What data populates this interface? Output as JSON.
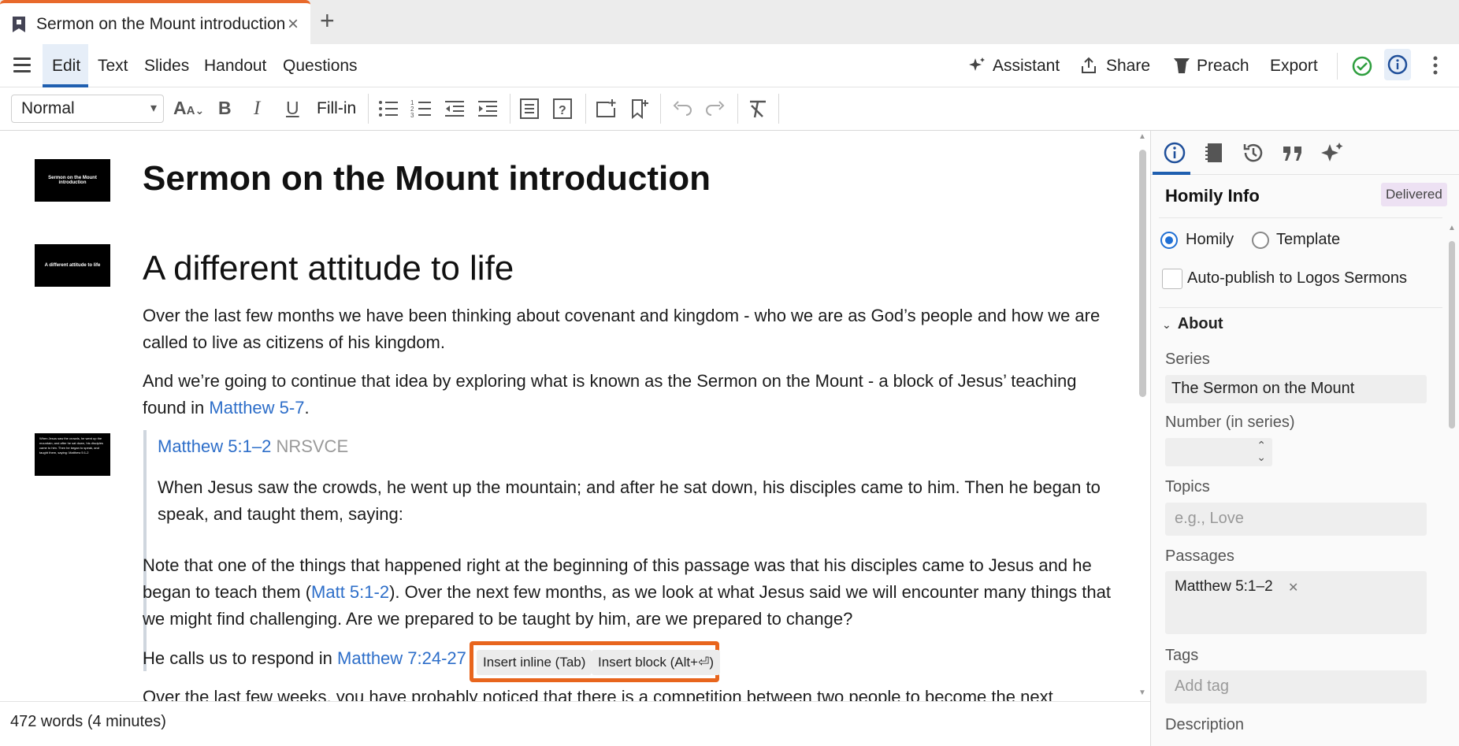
{
  "tab": {
    "title": "Sermon on the Mount introduction",
    "close": "×",
    "new_tab": "+"
  },
  "menu": {
    "items": [
      "Edit",
      "Text",
      "Slides",
      "Handout",
      "Questions"
    ],
    "active": "Edit",
    "right": {
      "assistant": "Assistant",
      "share": "Share",
      "preach": "Preach",
      "export": "Export"
    }
  },
  "toolbar": {
    "style_value": "Normal",
    "fill_in": "Fill-in"
  },
  "document": {
    "title": "Sermon on the Mount introduction",
    "thumb1": "Sermon on the Mount introduction",
    "heading2": "A different attitude to life",
    "thumb2": "A different attitude to life",
    "para1": "Over the last few months we have been thinking about covenant and kingdom - who we are as God’s people and how we are called to live as citizens of his kingdom.",
    "para2_pre": "And we’re going to continue that idea by exploring what is known as the Sermon on the Mount - a block of Jesus’ teaching found in ",
    "para2_link": "Matthew 5-7",
    "para2_post": ".",
    "quote_ref": "Matthew 5:1–2",
    "quote_version": "NRSVCE",
    "quote_text": "When Jesus saw the crowds, he went up the mountain; and after he sat down, his disciples came to him. Then he began to speak, and taught them, saying:",
    "thumb3": "When Jesus saw the crowds, he went up the mountain; and after he sat down, his disciples came to him. Then he began to speak, and taught them, saying: Matthew 5:1-2",
    "para3_pre": "Note that one of the things that happened right at the beginning of this passage was that his disciples came to Jesus and he began to teach them (",
    "para3_link": "Matt 5:1-2",
    "para3_post": "). Over the next few months, as we look at what Jesus said we will encounter many things that we might find challenging. Are we prepared to be taught by him, are we prepared to change?",
    "para4_pre": "He calls us to respond in ",
    "para4_link": "Matthew 7:24-27",
    "insert_inline": "Insert inline (Tab)",
    "insert_block": "Insert block (Alt+⏎)",
    "para5_cut": "Over the last few weeks, you have probably noticed that there is a competition between two people to become the next"
  },
  "status": {
    "words": "472 words (4 minutes)"
  },
  "panel": {
    "title": "Homily Info",
    "badge": "Delivered",
    "radio_homily": "Homily",
    "radio_template": "Template",
    "auto_publish": "Auto-publish to Logos Sermons",
    "about": "About",
    "series_label": "Series",
    "series_value": "The Sermon on the Mount",
    "number_label": "Number (in series)",
    "topics_label": "Topics",
    "topics_placeholder": "e.g., Love",
    "passages_label": "Passages",
    "passage_tag": "Matthew 5:1–2",
    "tags_label": "Tags",
    "tags_placeholder": "Add tag",
    "description_label": "Description"
  },
  "colors": {
    "accent": "#1f5fb0",
    "tab_indicator": "#e8692b",
    "link": "#2d6ec9",
    "suggest_border": "#e8651d",
    "ok": "#2e9e3e",
    "badge_bg": "#ede1f3"
  }
}
